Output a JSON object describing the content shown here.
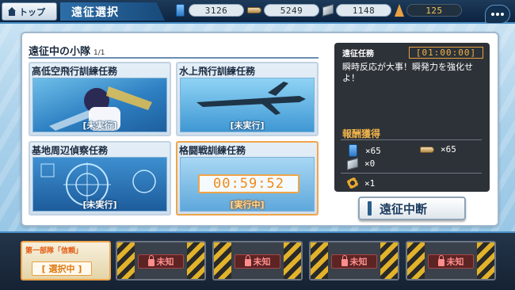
{
  "header": {
    "back_label": "トップ",
    "title": "遠征選択"
  },
  "resources": {
    "fuel": "3126",
    "ammo": "5249",
    "steel": "1148",
    "bauxite": "125"
  },
  "expedition": {
    "section_title": "遠征中の小隊",
    "count": "1/1",
    "missions": [
      {
        "name": "高低空飛行訓練任務",
        "status": "[未実行]"
      },
      {
        "name": "水上飛行訓練任務",
        "status": "[未実行]"
      },
      {
        "name": "基地周辺偵察任務",
        "status": "[未実行]"
      },
      {
        "name": "格闘戦訓練任務",
        "status": "[実行中]",
        "timer": "00:59:52"
      }
    ]
  },
  "detail": {
    "title": "遠征任務",
    "timer": "[01:00:00]",
    "description": "瞬時反応が大事！瞬発力を強化せよ！",
    "reward_title": "報酬獲得",
    "rewards": {
      "fuel": "×65",
      "ammo": "×65",
      "steel": "×0",
      "gear": "×1"
    }
  },
  "stop_button": "遠征中断",
  "fleet": {
    "slot1_name": "第一部隊「信頼」",
    "slot1_state": "[ 選択中 ]",
    "locked_label": "未知"
  }
}
